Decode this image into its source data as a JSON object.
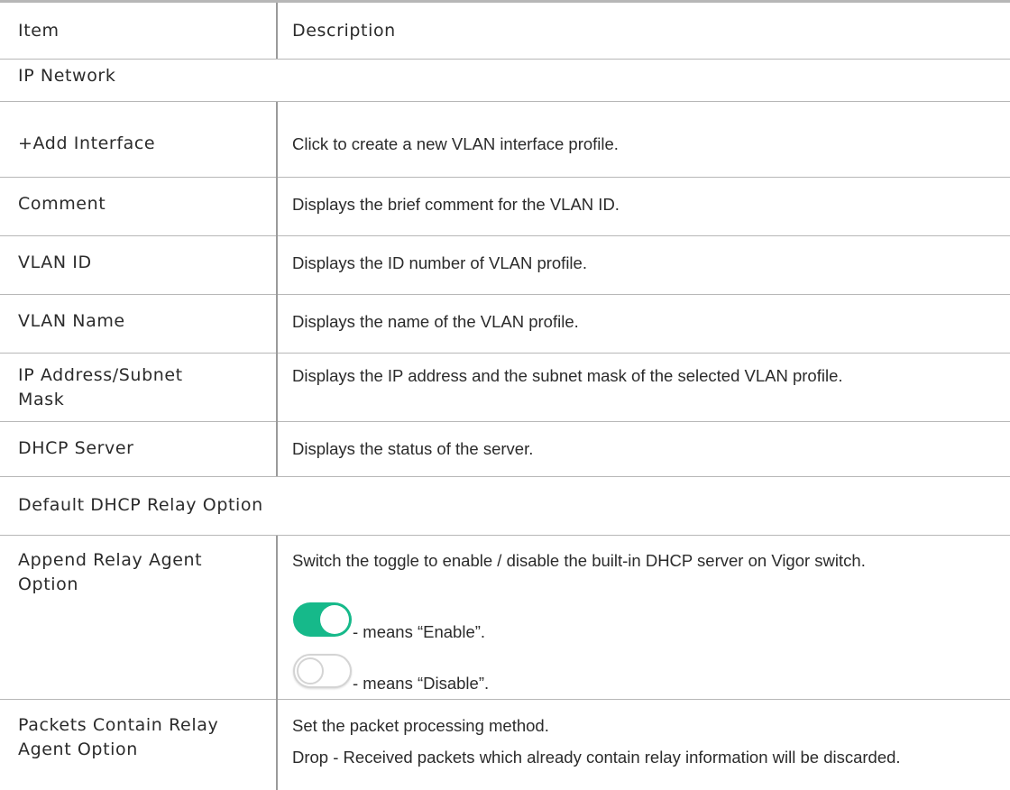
{
  "header": {
    "item": "Item",
    "description": "Description"
  },
  "sections": [
    {
      "title": "IP Network",
      "rows": [
        {
          "item": "+Add Interface",
          "description": "Click to create a new VLAN interface profile."
        },
        {
          "item": "Comment",
          "description": "Displays the brief comment for the VLAN ID."
        },
        {
          "item": "VLAN ID",
          "description": "Displays the ID number of VLAN profile."
        },
        {
          "item": "VLAN Name",
          "description": "Displays the name of the VLAN profile."
        },
        {
          "item": "IP Address/Subnet Mask",
          "description": "Displays the IP address and the subnet mask of the selected VLAN profile."
        },
        {
          "item": "DHCP Server",
          "description": "Displays the status of the server."
        }
      ]
    },
    {
      "title": "Default DHCP Relay Option",
      "rows": [
        {
          "item": "Append Relay Agent Option",
          "description": "Switch the toggle to enable / disable the built-in DHCP server on Vigor switch.",
          "toggle_on_text": "- means “Enable”.",
          "toggle_off_text": "- means “Disable”."
        },
        {
          "item": "Packets Contain Relay Agent Option",
          "description": "Set the packet processing method.",
          "description_2": "Drop - Received packets which already contain relay information will be discarded."
        }
      ]
    }
  ],
  "colors": {
    "toggle_on": "#16b98a",
    "border": "#b7b7b7",
    "text": "#2b2b2b"
  }
}
